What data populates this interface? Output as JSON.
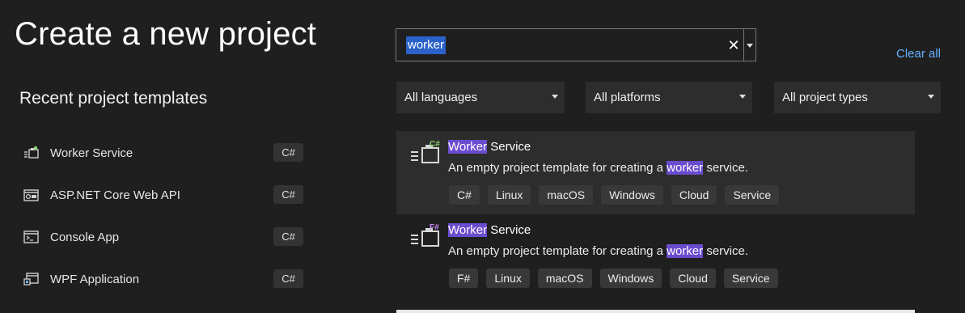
{
  "header": {
    "title": "Create a new project",
    "recent_title": "Recent project templates"
  },
  "recent": [
    {
      "label": "Worker Service",
      "tag": "C#",
      "icon": "worker-service-icon"
    },
    {
      "label": "ASP.NET Core Web API",
      "tag": "C#",
      "icon": "web-api-icon"
    },
    {
      "label": "Console App",
      "tag": "C#",
      "icon": "console-app-icon"
    },
    {
      "label": "WPF Application",
      "tag": "C#",
      "icon": "wpf-app-icon"
    }
  ],
  "search": {
    "value": "worker",
    "clear_glyph": "✕",
    "clear_all": "Clear all"
  },
  "filters": {
    "language": "All languages",
    "platform": "All platforms",
    "project_type": "All project types"
  },
  "results": [
    {
      "title_highlight": "Worker",
      "title_rest": " Service",
      "desc_before": "An empty project template for creating a ",
      "desc_highlight": "worker",
      "desc_after": " service.",
      "lang_badge": "C#",
      "tags": [
        "C#",
        "Linux",
        "macOS",
        "Windows",
        "Cloud",
        "Service"
      ],
      "selected": true
    },
    {
      "title_highlight": "Worker",
      "title_rest": " Service",
      "desc_before": "An empty project template for creating a ",
      "desc_highlight": "worker",
      "desc_after": " service.",
      "lang_badge": "F#",
      "tags": [
        "F#",
        "Linux",
        "macOS",
        "Windows",
        "Cloud",
        "Service"
      ],
      "selected": false
    }
  ],
  "colors": {
    "background": "#1f1f1f",
    "selected_row": "#2d2d2d",
    "highlight": "#6a4ccf",
    "link": "#64b0ff",
    "search_selection": "#2a62c9"
  }
}
